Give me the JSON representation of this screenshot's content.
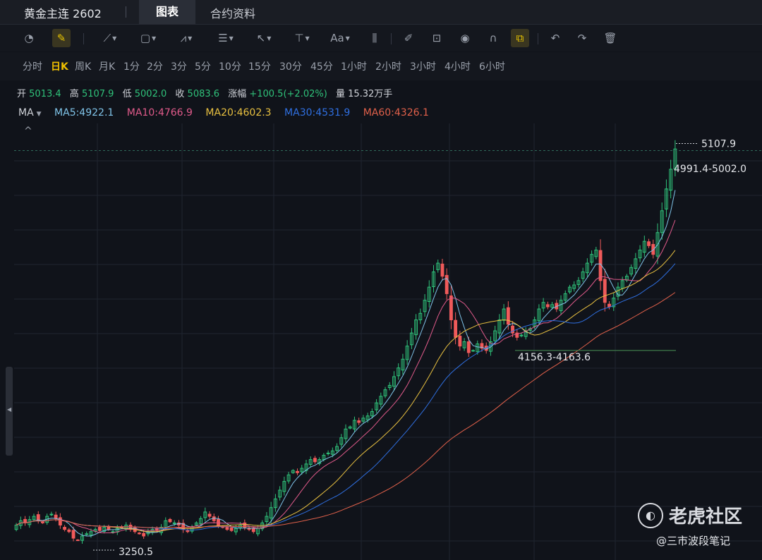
{
  "header": {
    "symbol": "黄金主连 2602",
    "tab_chart": "图表",
    "tab_info": "合约资料"
  },
  "toolbar": {
    "icons": [
      "gauge-icon",
      "draw-pen-icon",
      "line-tool-icon",
      "rectangle-tool-icon",
      "pattern-tool-icon",
      "fib-tool-icon",
      "arrow-tool-icon",
      "vertical-line-tool-icon",
      "text-tool-icon",
      "bar-tool-icon",
      "eraser-icon",
      "lock-icon",
      "eye-icon",
      "magnet-icon",
      "link-icon",
      "undo-icon",
      "redo-icon",
      "delete-icon"
    ]
  },
  "periods": [
    "分时",
    "日K",
    "周K",
    "月K",
    "1分",
    "2分",
    "3分",
    "5分",
    "10分",
    "15分",
    "30分",
    "45分",
    "1小时",
    "2小时",
    "3小时",
    "4小时",
    "6小时"
  ],
  "selected_period": "日K",
  "ohlc": {
    "open_label": "开",
    "open": "5013.4",
    "high_label": "高",
    "high": "5107.9",
    "low_label": "低",
    "low": "5002.0",
    "close_label": "收",
    "close": "5083.6",
    "change_label": "涨幅",
    "change": "+100.5(+2.02%)",
    "volume_label": "量",
    "volume": "15.32万手"
  },
  "ma_legend": {
    "title": "MA",
    "ma5": "MA5:4922.1",
    "ma10": "MA10:4766.9",
    "ma20": "MA20:4602.3",
    "ma30": "MA30:4531.9",
    "ma60": "MA60:4326.1"
  },
  "colors": {
    "up": "#2fc27a",
    "down": "#f05a5a",
    "ma5": "#7fc3e8",
    "ma10": "#e05a8a",
    "ma20": "#e8c040",
    "ma30": "#2f6fe0",
    "ma60": "#e0604a"
  },
  "chart_data": {
    "type": "candlestick",
    "ylim": [
      3200,
      5200
    ],
    "grid": true,
    "annotations": {
      "high_label": "5107.9",
      "gap_upper": "4991.4-5002.0",
      "gap_lower": "4156.3-4163.6",
      "low_label": "3250.5"
    },
    "closes": [
      3360,
      3380,
      3370,
      3385,
      3400,
      3380,
      3370,
      3400,
      3410,
      3390,
      3360,
      3340,
      3330,
      3300,
      3290,
      3310,
      3320,
      3330,
      3340,
      3335,
      3350,
      3340,
      3330,
      3345,
      3350,
      3360,
      3340,
      3330,
      3320,
      3310,
      3330,
      3340,
      3335,
      3350,
      3380,
      3375,
      3370,
      3360,
      3340,
      3330,
      3350,
      3370,
      3390,
      3420,
      3400,
      3380,
      3360,
      3350,
      3340,
      3335,
      3345,
      3360,
      3350,
      3340,
      3330,
      3345,
      3370,
      3400,
      3440,
      3480,
      3520,
      3560,
      3590,
      3610,
      3600,
      3620,
      3640,
      3660,
      3650,
      3660,
      3680,
      3690,
      3700,
      3720,
      3760,
      3800,
      3810,
      3840,
      3830,
      3850,
      3860,
      3880,
      3920,
      3950,
      3980,
      4000,
      4040,
      4080,
      4120,
      4180,
      4240,
      4300,
      4330,
      4390,
      4450,
      4520,
      4560,
      4500,
      4420,
      4300,
      4220,
      4180,
      4200,
      4150,
      4160,
      4190,
      4170,
      4160,
      4200,
      4250,
      4300,
      4350,
      4280,
      4240,
      4220,
      4230,
      4250,
      4260,
      4300,
      4350,
      4380,
      4360,
      4370,
      4350,
      4390,
      4420,
      4450,
      4460,
      4480,
      4520,
      4560,
      4600,
      4620,
      4480,
      4380,
      4360,
      4400,
      4450,
      4480,
      4500,
      4540,
      4580,
      4620,
      4660,
      4640,
      4600,
      4700,
      4800,
      4900,
      4990,
      5083
    ]
  }
}
